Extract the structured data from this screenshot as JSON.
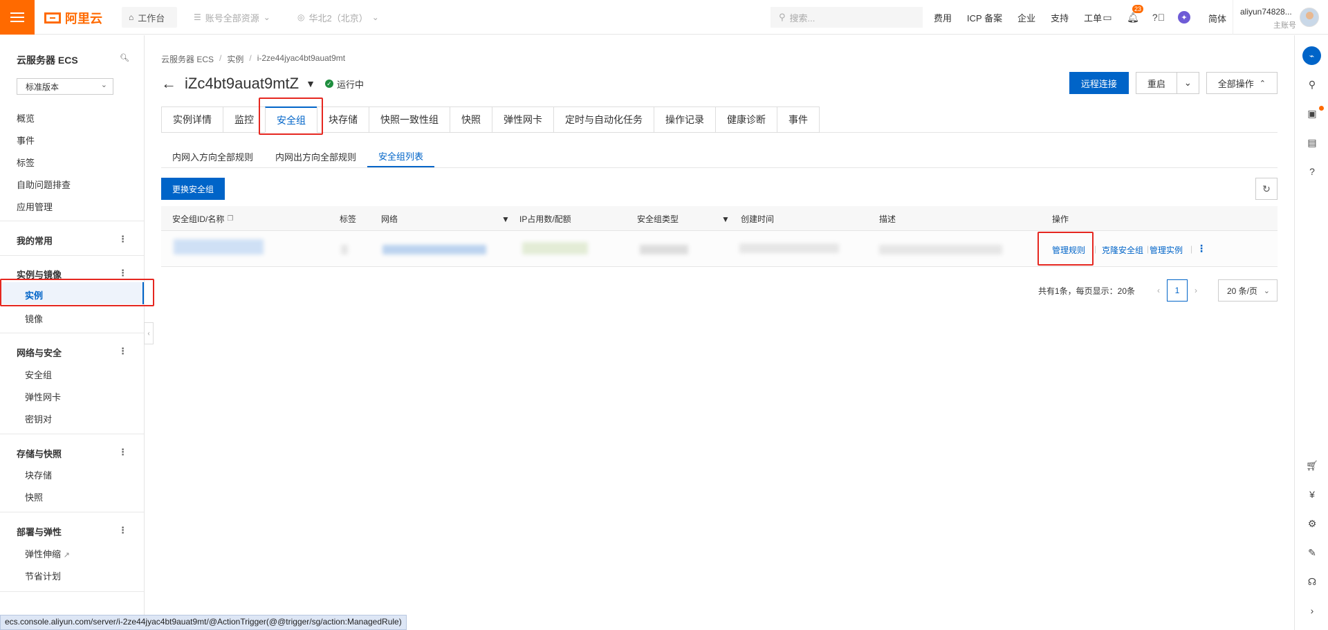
{
  "topbar": {
    "logo_text": "阿里云",
    "workbench": "工作台",
    "account_resources": "账号全部资源",
    "region": "华北2（北京）",
    "search_placeholder": "搜索...",
    "links": [
      "费用",
      "ICP 备案",
      "企业",
      "支持",
      "工单"
    ],
    "notification_count": "23",
    "language": "简体",
    "user_name": "aliyun74828...",
    "user_role": "主账号"
  },
  "sidebar": {
    "title": "云服务器 ECS",
    "version_select": "标准版本",
    "top_items": [
      "概览",
      "事件",
      "标签",
      "自助问题排查",
      "应用管理"
    ],
    "my_common": "我的常用",
    "group_instances": "实例与镜像",
    "item_instance": "实例",
    "item_image": "镜像",
    "group_network": "网络与安全",
    "item_security_group": "安全组",
    "item_eni": "弹性网卡",
    "item_keypair": "密钥对",
    "group_storage": "存储与快照",
    "item_block_storage": "块存储",
    "item_snapshot": "快照",
    "group_deploy": "部署与弹性",
    "item_autoscaling": "弹性伸缩",
    "item_savings": "节省计划"
  },
  "breadcrumb": [
    "云服务器 ECS",
    "实例",
    "i-2ze44jyac4bt9auat9mt"
  ],
  "header": {
    "instance_name": "iZc4bt9auat9mtZ",
    "status": "运行中",
    "remote_connect": "远程连接",
    "restart": "重启",
    "all_actions": "全部操作"
  },
  "tabs": [
    "实例详情",
    "监控",
    "安全组",
    "块存储",
    "快照一致性组",
    "快照",
    "弹性网卡",
    "定时与自动化任务",
    "操作记录",
    "健康诊断",
    "事件"
  ],
  "active_tab": "安全组",
  "subtabs": [
    "内网入方向全部规则",
    "内网出方向全部规则",
    "安全组列表"
  ],
  "active_subtab": "安全组列表",
  "toolbar": {
    "change_sg": "更换安全组"
  },
  "table": {
    "headers": [
      "安全组ID/名称",
      "标签",
      "网络",
      "IP占用数/配额",
      "安全组类型",
      "创建时间",
      "描述",
      "操作"
    ],
    "row_actions": [
      "管理规则",
      "克隆安全组",
      "管理实例"
    ]
  },
  "pager": {
    "summary": "共有1条，每页显示：20条",
    "current_page": "1",
    "page_size": "20 条/页"
  },
  "statusbar": {
    "url": "ecs.console.aliyun.com/server/i-2ze44jyac4bt9auat9mt/@ActionTrigger(@@trigger/sg/action:ManagedRule)"
  },
  "colors": {
    "brand": "#ff6a00",
    "primary": "#0064c8",
    "highlight": "#e5261f"
  }
}
